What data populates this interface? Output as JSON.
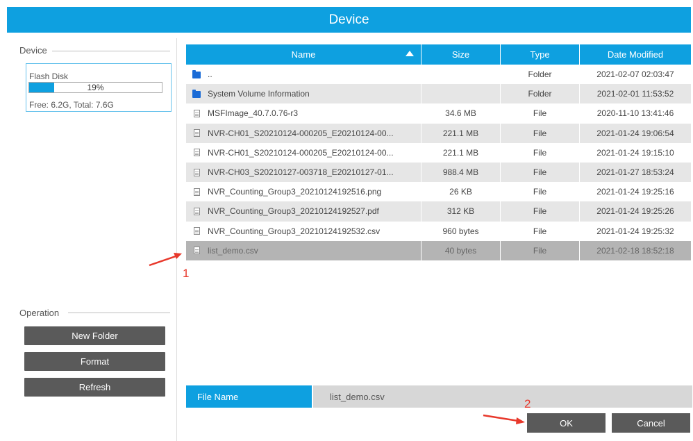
{
  "window": {
    "title": "Device"
  },
  "device_panel": {
    "group_label": "Device",
    "disk_name": "Flash Disk",
    "usage_percent_label": "19%",
    "usage_fraction": 0.19,
    "free_total": "Free: 6.2G, Total: 7.6G"
  },
  "operation_panel": {
    "group_label": "Operation",
    "buttons": [
      "New Folder",
      "Format",
      "Refresh"
    ]
  },
  "table": {
    "columns": [
      "Name",
      "Size",
      "Type",
      "Date Modified"
    ],
    "sort": {
      "column": "Name",
      "direction": "ascending"
    },
    "rows": [
      {
        "icon": "folder-icon",
        "name": "..",
        "size": "",
        "type": "Folder",
        "date": "2021-02-07 02:03:47"
      },
      {
        "icon": "folder-icon",
        "name": "System Volume Information",
        "size": "",
        "type": "Folder",
        "date": "2021-02-01 11:53:52"
      },
      {
        "icon": "file-icon",
        "name": "MSFImage_40.7.0.76-r3",
        "size": "34.6 MB",
        "type": "File",
        "date": "2020-11-10 13:41:46"
      },
      {
        "icon": "file-icon",
        "name": "NVR-CH01_S20210124-000205_E20210124-00...",
        "size": "221.1 MB",
        "type": "File",
        "date": "2021-01-24 19:06:54"
      },
      {
        "icon": "file-icon",
        "name": "NVR-CH01_S20210124-000205_E20210124-00...",
        "size": "221.1 MB",
        "type": "File",
        "date": "2021-01-24 19:15:10"
      },
      {
        "icon": "file-icon",
        "name": "NVR-CH03_S20210127-003718_E20210127-01...",
        "size": "988.4 MB",
        "type": "File",
        "date": "2021-01-27 18:53:24"
      },
      {
        "icon": "file-icon",
        "name": "NVR_Counting_Group3_20210124192516.png",
        "size": "26 KB",
        "type": "File",
        "date": "2021-01-24 19:25:16"
      },
      {
        "icon": "file-icon",
        "name": "NVR_Counting_Group3_20210124192527.pdf",
        "size": "312 KB",
        "type": "File",
        "date": "2021-01-24 19:25:26"
      },
      {
        "icon": "file-icon",
        "name": "NVR_Counting_Group3_20210124192532.csv",
        "size": "960 bytes",
        "type": "File",
        "date": "2021-01-24 19:25:32"
      },
      {
        "icon": "file-icon",
        "name": "list_demo.csv",
        "size": "40 bytes",
        "type": "File",
        "date": "2021-02-18 18:52:18",
        "selected": true
      }
    ]
  },
  "file_name": {
    "label": "File Name",
    "value": "list_demo.csv"
  },
  "dialog_buttons": {
    "ok": "OK",
    "cancel": "Cancel"
  },
  "annotations": {
    "marker1": "1",
    "marker2": "2",
    "color": "#e8382b"
  },
  "colors": {
    "accent": "#0ea0e0",
    "button": "#5a5a5a",
    "selected_row": "#b4b4b4"
  }
}
